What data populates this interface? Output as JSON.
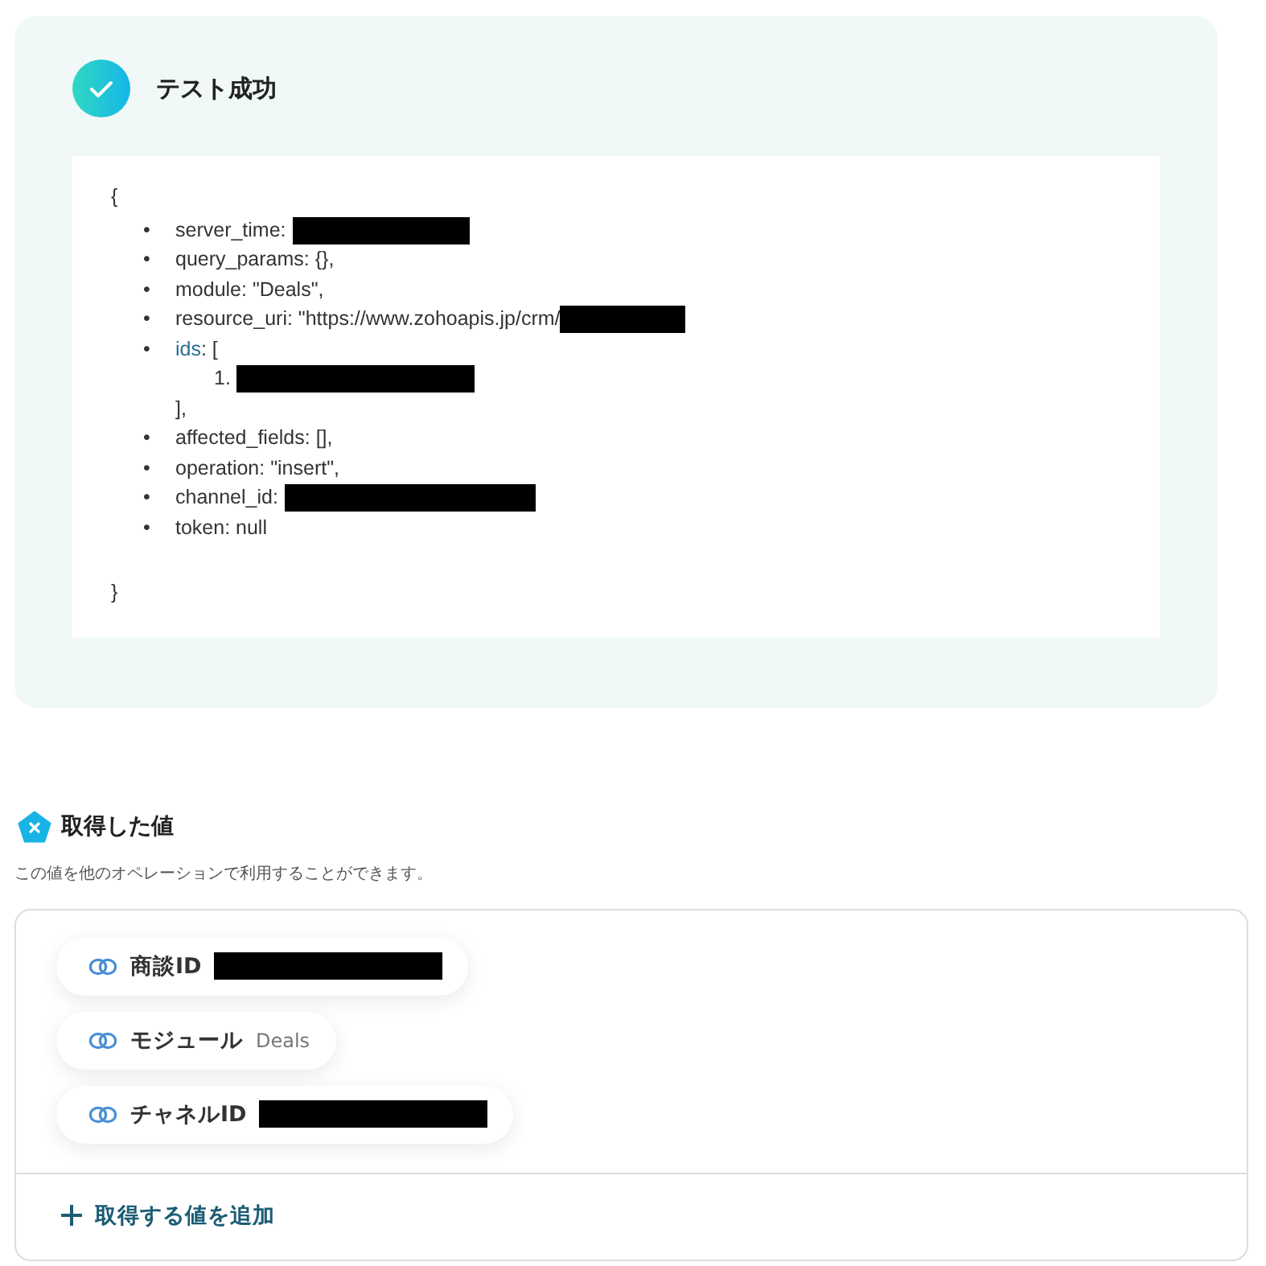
{
  "test_result": {
    "title": "テスト成功",
    "open_brace": "{",
    "close_brace": "}",
    "lines": [
      {
        "kind": "plain",
        "marker": "•",
        "text": "server_time:",
        "redacted": true
      },
      {
        "kind": "plain",
        "marker": "•",
        "text": "query_params: {},",
        "redacted": false
      },
      {
        "kind": "plain",
        "marker": "•",
        "text": "module: \"Deals\",",
        "redacted": false
      },
      {
        "kind": "plain",
        "marker": "•",
        "text": "resource_uri: \"https://www.zohoapis.jp/crm/",
        "redacted": true
      },
      {
        "kind": "array",
        "marker": "•",
        "key": "ids",
        "text": ": [",
        "items": [
          {
            "number": "1.",
            "redacted": true
          }
        ],
        "close": "],"
      },
      {
        "kind": "plain",
        "marker": "•",
        "text": "affected_fields: [],",
        "redacted": false
      },
      {
        "kind": "plain",
        "marker": "•",
        "text": "operation: \"insert\",",
        "redacted": false
      },
      {
        "kind": "plain",
        "marker": "•",
        "text": "channel_id:",
        "redacted": true
      },
      {
        "kind": "plain",
        "marker": "•",
        "text": "token: null",
        "redacted": false
      }
    ]
  },
  "obtained_values": {
    "title": "取得した値",
    "description": "この値を他のオペレーションで利用することができます。",
    "values": [
      {
        "label": "商談ID",
        "redacted": true
      },
      {
        "label": "モジュール",
        "value": "Deals",
        "redacted": false
      },
      {
        "label": "チャネルID",
        "redacted": true
      }
    ],
    "add_button": "取得する値を追加"
  }
}
